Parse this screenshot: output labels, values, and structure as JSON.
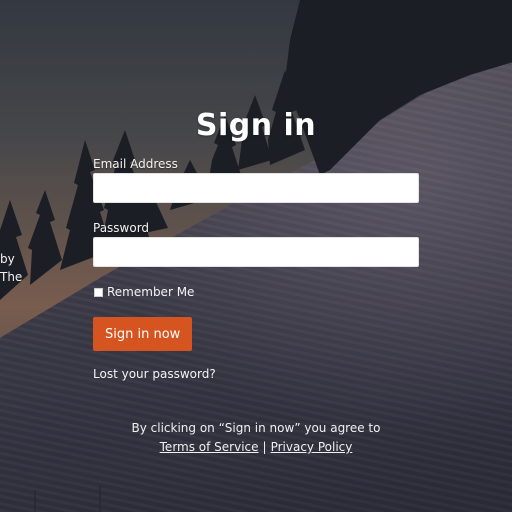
{
  "form": {
    "title": "Sign in",
    "email_label": "Email Address",
    "email_value": "",
    "password_label": "Password",
    "password_value": "",
    "remember_label": "Remember Me",
    "remember_checked": false,
    "submit_label": "Sign in now",
    "lost_password_label": "Lost your password?"
  },
  "legal": {
    "agree_text": "By clicking on “Sign in now” you agree to",
    "terms_label": "Terms of Service",
    "separator": "|",
    "privacy_label": "Privacy Policy"
  },
  "side_text": {
    "line1": "by",
    "line2": "The"
  },
  "colors": {
    "accent": "#d5541f",
    "text": "#ffffff"
  }
}
